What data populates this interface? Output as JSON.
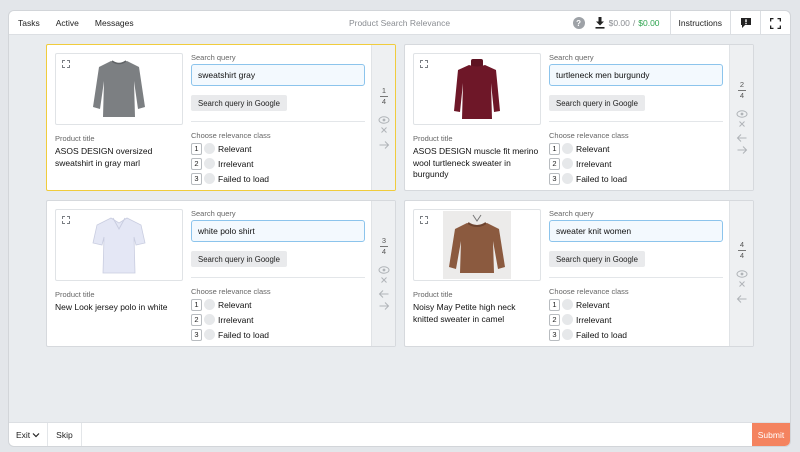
{
  "nav": {
    "tasks": "Tasks",
    "active": "Active",
    "messages": "Messages",
    "title": "Product Search Relevance"
  },
  "wallet": {
    "balance_left": "$0.00",
    "separator": "/",
    "balance_right": "$0.00"
  },
  "toolbar": {
    "instructions": "Instructions",
    "help_glyph": "?"
  },
  "labels": {
    "search_query": "Search query",
    "google_button": "Search query in Google",
    "product_title": "Product title",
    "choose_class": "Choose relevance class"
  },
  "options": [
    {
      "key": "1",
      "label": "Relevant"
    },
    {
      "key": "2",
      "label": "Irrelevant"
    },
    {
      "key": "3",
      "label": "Failed to load"
    }
  ],
  "cards": [
    {
      "query": "sweatshirt gray",
      "title": "ASOS DESIGN oversized sweatshirt in gray marl",
      "index": "1",
      "total": "4",
      "image_icon": "gray-sweatshirt-image"
    },
    {
      "query": "turtleneck men burgundy",
      "title": "ASOS DESIGN muscle fit merino wool turtleneck sweater in burgundy",
      "index": "2",
      "total": "4",
      "image_icon": "burgundy-turtleneck-image"
    },
    {
      "query": "white polo shirt",
      "title": "New Look jersey polo in white",
      "index": "3",
      "total": "4",
      "image_icon": "white-polo-image"
    },
    {
      "query": "sweater knit women",
      "title": "Noisy May Petite high neck knitted sweater in camel",
      "index": "4",
      "total": "4",
      "image_icon": "camel-sweater-image"
    }
  ],
  "bottom": {
    "exit": "Exit",
    "skip": "Skip",
    "submit": "Submit"
  },
  "colors": {
    "active_border": "#f0cc3c",
    "submit": "#f4835f",
    "balance_green": "#2ea44f",
    "query_border": "#8cc4ec"
  }
}
